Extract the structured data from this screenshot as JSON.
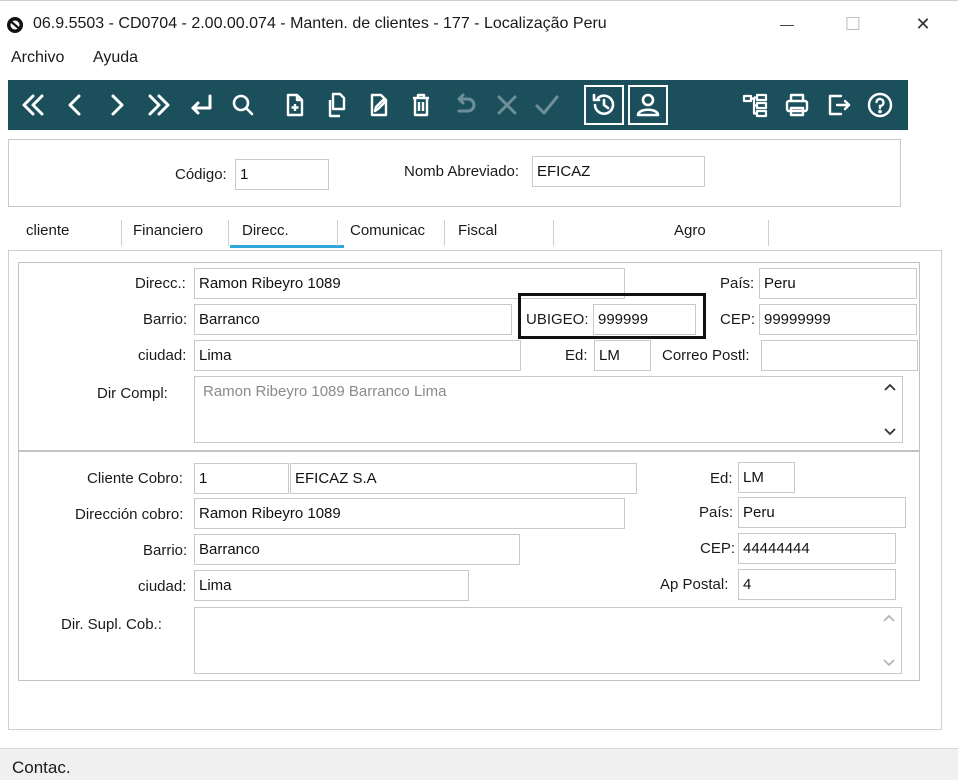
{
  "window": {
    "title": "06.9.5503 - CD0704 - 2.00.00.074 - Manten. de clientes - 177 - Localização Peru",
    "minimize_glyph": "—",
    "maximize_glyph": "☐",
    "close_glyph": "✕"
  },
  "menu": {
    "archivo": "Archivo",
    "ayuda": "Ayuda"
  },
  "toolbar": {
    "background": "#1b4f5c",
    "icon_color": "#ffffff",
    "disabled_icon_color": "#6f8f98",
    "buttons": [
      {
        "icon": "first-record-icon"
      },
      {
        "icon": "previous-record-icon"
      },
      {
        "icon": "next-record-icon"
      },
      {
        "icon": "last-record-icon"
      },
      {
        "icon": "enter-icon"
      },
      {
        "icon": "search-icon"
      },
      {
        "icon": "new-document-icon"
      },
      {
        "icon": "copy-document-icon"
      },
      {
        "icon": "edit-document-icon"
      },
      {
        "icon": "delete-icon"
      },
      {
        "icon": "undo-icon",
        "disabled": true
      },
      {
        "icon": "cancel-icon",
        "disabled": true
      },
      {
        "icon": "confirm-icon",
        "disabled": true
      },
      {
        "icon": "history-icon"
      },
      {
        "icon": "user-icon"
      },
      {
        "icon": "tree-icon"
      },
      {
        "icon": "print-icon"
      },
      {
        "icon": "exit-icon"
      },
      {
        "icon": "help-icon"
      }
    ]
  },
  "header": {
    "codigo_label": "Código:",
    "codigo_value": "1",
    "nomb_label": "Nomb Abreviado:",
    "nomb_value": "EFICAZ"
  },
  "tabs": {
    "cliente": "cliente",
    "financiero": "Financiero",
    "direcc": "Direcc.",
    "comunicac": "Comunicac",
    "fiscal": "Fiscal",
    "agro": "Agro",
    "active": "Direcc.",
    "active_color": "#2ea6d9"
  },
  "address": {
    "direcc_label": "Direcc.:",
    "direcc_value": "Ramon Ribeyro 1089",
    "pais_label": "País:",
    "pais_value": "Peru",
    "barrio_label": "Barrio:",
    "barrio_value": "Barranco",
    "ubigeo_label": "UBIGEO:",
    "ubigeo_value": "999999",
    "cep_label": "CEP:",
    "cep_value": "99999999",
    "ciudad_label": "ciudad:",
    "ciudad_value": "Lima",
    "ed_label": "Ed:",
    "ed_value": "LM",
    "correo_label": "Correo Postl:",
    "correo_value": "",
    "dircompl_label": "Dir Compl:",
    "dircompl_value": "Ramon Ribeyro  1089 Barranco Lima"
  },
  "billing": {
    "cliente_cobro_label": "Cliente Cobro:",
    "cliente_cobro_code": "1",
    "cliente_cobro_name": "EFICAZ S.A",
    "ed_label": "Ed:",
    "ed_value": "LM",
    "direccion_label": "Dirección cobro:",
    "direccion_value": "Ramon Ribeyro 1089",
    "pais_label": "País:",
    "pais_value": "Peru",
    "barrio_label": "Barrio:",
    "barrio_value": "Barranco",
    "cep_label": "CEP:",
    "cep_value": "44444444",
    "ciudad_label": "ciudad:",
    "ciudad_value": "Lima",
    "ap_label": "Ap Postal:",
    "ap_value": "4",
    "dirsupl_label": "Dir. Supl. Cob.:",
    "dirsupl_value": ""
  },
  "status": {
    "text": "Contac."
  }
}
